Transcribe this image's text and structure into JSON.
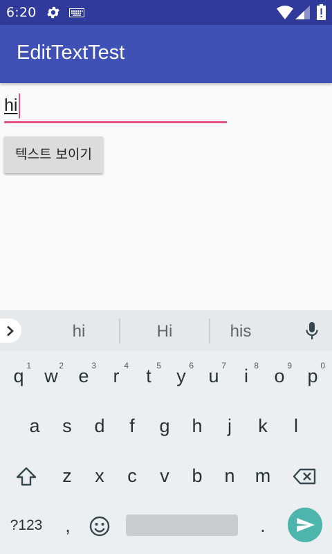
{
  "status_bar": {
    "time": "6:20",
    "icons": [
      "gear-icon",
      "keyboard-icon",
      "wifi-icon",
      "signal-icon",
      "battery-icon"
    ]
  },
  "app_bar": {
    "title": "EditTextTest"
  },
  "edit_text": {
    "value": "hi"
  },
  "show_button": {
    "label": "텍스트 보이기"
  },
  "keyboard": {
    "suggestions": [
      "hi",
      "Hi",
      "his"
    ],
    "row1": [
      {
        "key": "q",
        "hint": "1"
      },
      {
        "key": "w",
        "hint": "2"
      },
      {
        "key": "e",
        "hint": "3"
      },
      {
        "key": "r",
        "hint": "4"
      },
      {
        "key": "t",
        "hint": "5"
      },
      {
        "key": "y",
        "hint": "6"
      },
      {
        "key": "u",
        "hint": "7"
      },
      {
        "key": "i",
        "hint": "8"
      },
      {
        "key": "o",
        "hint": "9"
      },
      {
        "key": "p",
        "hint": "0"
      }
    ],
    "row2": [
      "a",
      "s",
      "d",
      "f",
      "g",
      "h",
      "j",
      "k",
      "l"
    ],
    "row3": [
      "z",
      "x",
      "c",
      "v",
      "b",
      "n",
      "m"
    ],
    "symbols_label": "?123",
    "comma": ",",
    "period": "."
  },
  "colors": {
    "status_bar": "#2f3a9a",
    "app_bar": "#3f51b5",
    "accent": "#e8508a",
    "enter_key": "#4db6ac"
  }
}
